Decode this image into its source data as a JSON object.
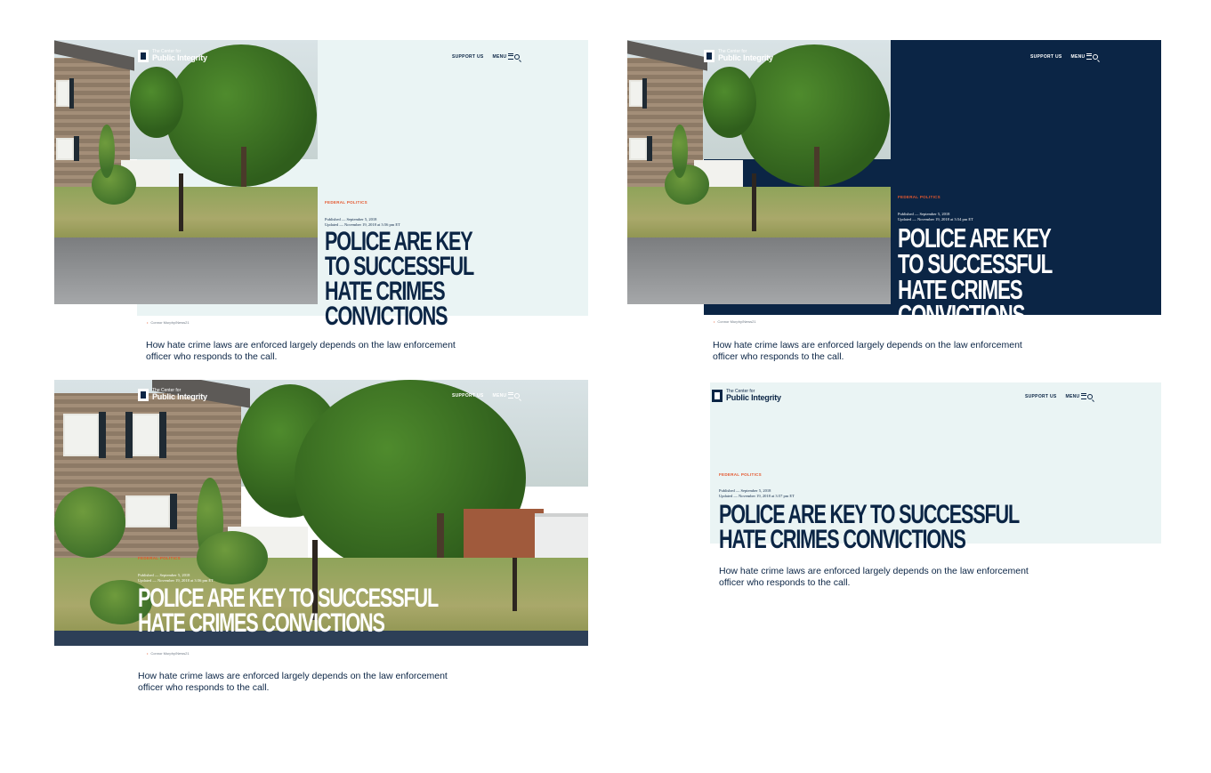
{
  "brand": {
    "line1": "The Center for",
    "line2": "Public Integrity"
  },
  "nav": {
    "support": "SUPPORT US",
    "menu": "MENU"
  },
  "article": {
    "category": "FEDERAL POLITICS",
    "published": "Published — September 5, 2018",
    "updated_a": "Updated — November 19, 2018 at 3:56 pm ET",
    "updated_b": "Updated — November 19, 2018 at 3:54 pm ET",
    "updated_d": "Updated — November 19, 2018 at 3:57 pm ET",
    "headline": "POLICE ARE KEY TO SUCCESSFUL HATE CRIMES CONVICTIONS",
    "credit": "Connor Murphy/News21",
    "dek": "How hate crime laws are enforced largely depends on the law enforcement officer who responds to the call."
  },
  "colors": {
    "navy": "#0b2545",
    "mint": "#eaf4f4",
    "accent": "#e4572e"
  },
  "icons": [
    "menu-icon",
    "search-icon",
    "logo-mark",
    "location-pin-icon"
  ]
}
